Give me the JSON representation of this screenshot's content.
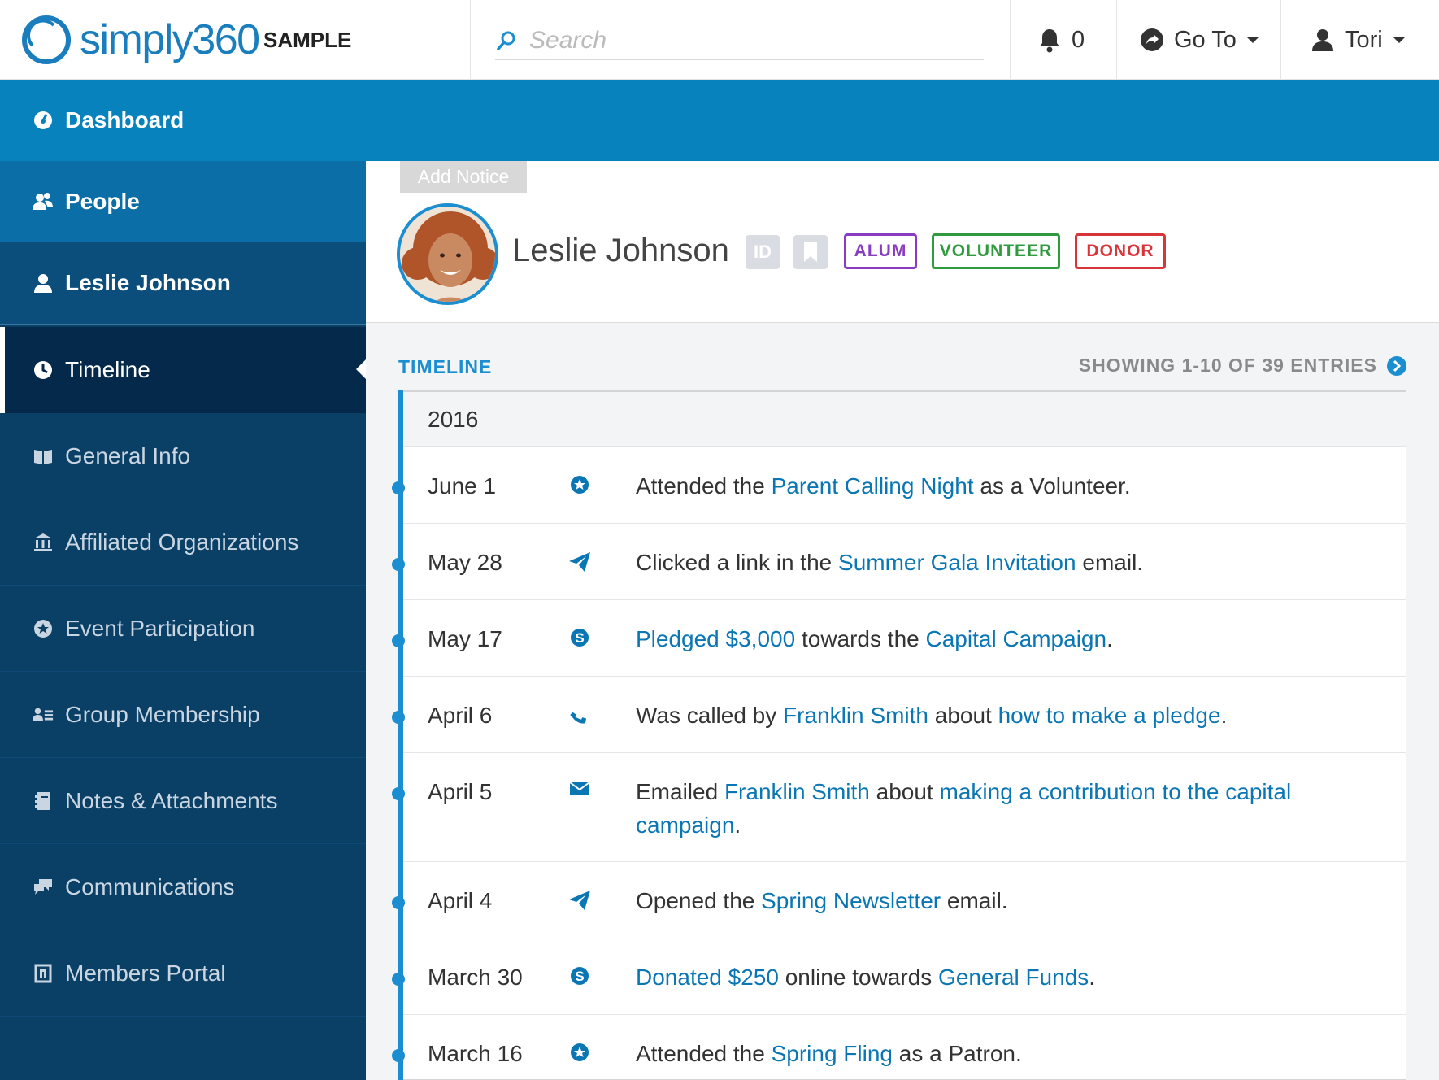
{
  "app": {
    "logo_text": "simply360",
    "org_label": "SAMPLE"
  },
  "search": {
    "placeholder": "Search"
  },
  "topbar": {
    "notifications_count": "0",
    "goto_label": "Go To",
    "user_name": "Tori"
  },
  "nav": {
    "dashboard": "Dashboard",
    "people": "People",
    "person": "Leslie Johnson",
    "timeline": "Timeline",
    "items": [
      "General Info",
      "Affiliated Organizations",
      "Event Participation",
      "Group Membership",
      "Notes & Attachments",
      "Communications",
      "Members Portal"
    ]
  },
  "profile": {
    "add_notice": "Add Notice",
    "name": "Leslie Johnson",
    "id_badge": "ID",
    "tags": [
      {
        "label": "ALUM",
        "color": "#8a3cc0"
      },
      {
        "label": "VOLUNTEER",
        "color": "#2f9b3e"
      },
      {
        "label": "DONOR",
        "color": "#d8353a"
      }
    ]
  },
  "timeline": {
    "title": "TIMELINE",
    "showing": "SHOWING 1-10 OF 39 ENTRIES",
    "year": "2016",
    "entries": [
      {
        "date": "June 1",
        "icon": "star-icon",
        "parts": [
          [
            "Attended the ",
            0
          ],
          [
            "Parent Calling Night",
            1
          ],
          [
            " as a Volunteer.",
            0
          ]
        ]
      },
      {
        "date": "May 28",
        "icon": "paper-plane-icon",
        "parts": [
          [
            "Clicked a link in the ",
            0
          ],
          [
            "Summer Gala Invitation",
            1
          ],
          [
            " email.",
            0
          ]
        ]
      },
      {
        "date": "May 17",
        "icon": "dollar-icon",
        "parts": [
          [
            "Pledged $3,000",
            1
          ],
          [
            " towards the ",
            0
          ],
          [
            "Capital Campaign",
            1
          ],
          [
            ".",
            0
          ]
        ]
      },
      {
        "date": "April 6",
        "icon": "phone-icon",
        "parts": [
          [
            "Was called by ",
            0
          ],
          [
            "Franklin Smith",
            1
          ],
          [
            " about ",
            0
          ],
          [
            "how to make a pledge",
            1
          ],
          [
            ".",
            0
          ]
        ]
      },
      {
        "date": "April 5",
        "icon": "envelope-icon",
        "parts": [
          [
            "Emailed ",
            0
          ],
          [
            "Franklin Smith",
            1
          ],
          [
            " about ",
            0
          ],
          [
            "making a contribution to the capital campaign",
            1
          ],
          [
            ".",
            0
          ]
        ]
      },
      {
        "date": "April 4",
        "icon": "paper-plane-icon",
        "parts": [
          [
            "Opened the ",
            0
          ],
          [
            "Spring Newsletter",
            1
          ],
          [
            " email.",
            0
          ]
        ]
      },
      {
        "date": "March 30",
        "icon": "dollar-icon",
        "parts": [
          [
            "Donated $250",
            1
          ],
          [
            " online towards ",
            0
          ],
          [
            "General Funds",
            1
          ],
          [
            ".",
            0
          ]
        ]
      },
      {
        "date": "March 16",
        "icon": "star-icon",
        "parts": [
          [
            "Attended the ",
            0
          ],
          [
            "Spring Fling",
            1
          ],
          [
            " as a Patron.",
            0
          ]
        ]
      }
    ]
  },
  "colors": {
    "accent": "#1a8ed0",
    "sidebar": "#0a3f66",
    "dashbar": "#0782bc"
  }
}
